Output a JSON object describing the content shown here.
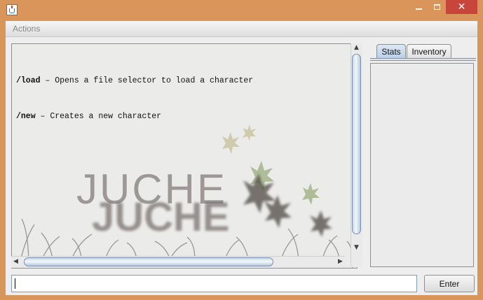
{
  "menubar": {
    "actions_label": "Actions"
  },
  "console": {
    "lines": [
      {
        "command": "/load",
        "description": " – Opens a file selector to load a character"
      },
      {
        "command": "/new",
        "description": " – Creates a new character"
      }
    ],
    "background": {
      "logo_text": "JUCHE"
    }
  },
  "tabs": {
    "stats": "Stats",
    "inventory": "Inventory",
    "selected": "Stats"
  },
  "input": {
    "value": "",
    "placeholder": ""
  },
  "buttons": {
    "enter": "Enter"
  },
  "window": {
    "close_glyph": "✕"
  },
  "icons": {
    "app": "java-cup-icon",
    "minimize": "minimize-icon",
    "maximize": "maximize-icon",
    "close": "close-icon",
    "scroll_up": "arrow-up-icon",
    "scroll_down": "arrow-down-icon",
    "scroll_left": "arrow-left-icon",
    "scroll_right": "arrow-right-icon"
  },
  "colors": {
    "titlebar": "#d9955a",
    "close": "#c7453a",
    "tab_selected": "#b9d0ea",
    "thumb": "#c9d7e8"
  }
}
